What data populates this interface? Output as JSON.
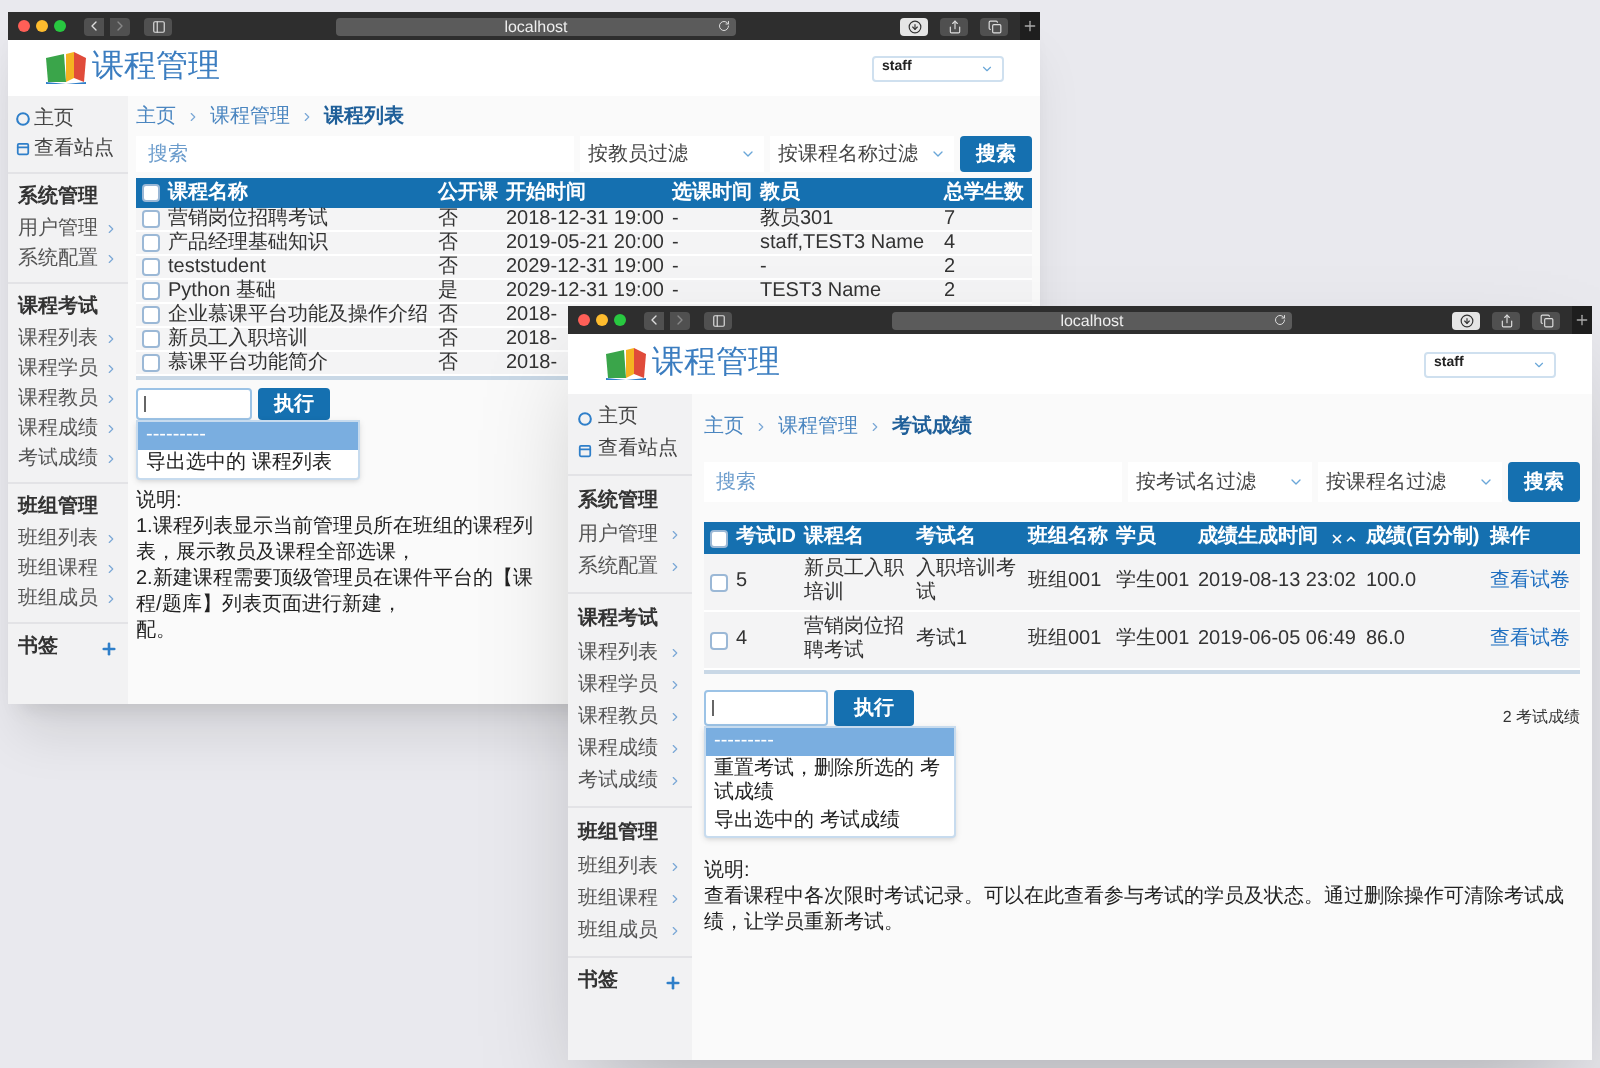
{
  "windows": [
    {
      "address": "localhost",
      "logo": "课程管理",
      "user": "staff",
      "sidebar": {
        "top": [
          {
            "kind": "home",
            "label": "主页"
          },
          {
            "kind": "site",
            "label": "查看站点"
          }
        ],
        "sections": [
          {
            "title": "系统管理",
            "items": [
              "用户管理",
              "系统配置"
            ]
          },
          {
            "title": "课程考试",
            "items": [
              "课程列表",
              "课程学员",
              "课程教员",
              "课程成绩",
              "考试成绩"
            ]
          },
          {
            "title": "班组管理",
            "items": [
              "班组列表",
              "班组课程",
              "班组成员"
            ]
          }
        ],
        "bookmarks": "书签"
      },
      "breadcrumb": [
        "主页",
        "课程管理",
        "课程列表"
      ],
      "search": {
        "placeholder": "搜索",
        "filters": [
          "按教员过滤",
          "按课程名称过滤"
        ],
        "button": "搜索"
      },
      "table": {
        "select_all": {
          "checked": false
        },
        "columns": [
          {
            "label": "课程名称",
            "kind": "text",
            "sorted": false
          },
          {
            "label": "公开课",
            "kind": "text",
            "sorted": false
          },
          {
            "label": "开始时间",
            "kind": "text",
            "sorted": false
          },
          {
            "label": "选课时间",
            "kind": "text",
            "sorted": false
          },
          {
            "label": "教员",
            "kind": "text",
            "sorted": false
          },
          {
            "label": "总学生数",
            "kind": "text",
            "sorted": false
          }
        ],
        "rows": [
          {
            "checked": false,
            "cells": [
              "营销岗位招聘考试",
              "否",
              "2018-12-31 19:00",
              "-",
              "教员301",
              "7"
            ]
          },
          {
            "checked": false,
            "cells": [
              "产品经理基础知识",
              "否",
              "2019-05-21 20:00",
              "-",
              "staff,TEST3 Name",
              "4"
            ]
          },
          {
            "checked": false,
            "cells": [
              "teststudent",
              "否",
              "2029-12-31 19:00",
              "-",
              "-",
              "2"
            ]
          },
          {
            "checked": false,
            "cells": [
              "Python 基础",
              "是",
              "2029-12-31 19:00",
              "-",
              "TEST3 Name",
              "2"
            ]
          },
          {
            "checked": false,
            "cells": [
              "企业慕课平台功能及操作介绍",
              "否",
              "2018-"
            ]
          },
          {
            "checked": false,
            "cells": [
              "新员工入职培训",
              "否",
              "2018-"
            ]
          },
          {
            "checked": false,
            "cells": [
              "慕课平台功能简介",
              "否",
              "2018-"
            ]
          }
        ]
      },
      "actions": {
        "options": [
          {
            "label": "---------",
            "selected": true
          },
          {
            "label": "导出选中的 课程列表",
            "selected": false
          }
        ],
        "button": "执行"
      },
      "notes": [
        "说明:",
        "1.课程列表显示当前管理员所在班组的课程列表，展示教员及课程全部选课，",
        "2.新建课程需要顶级管理员在课件平台的【课程/题库】列表页面进行新建，",
        "配。"
      ]
    },
    {
      "address": "localhost",
      "logo": "课程管理",
      "user": "staff",
      "sidebar": {
        "top": [
          {
            "kind": "home",
            "label": "主页"
          },
          {
            "kind": "site",
            "label": "查看站点"
          }
        ],
        "sections": [
          {
            "title": "系统管理",
            "items": [
              "用户管理",
              "系统配置"
            ]
          },
          {
            "title": "课程考试",
            "items": [
              "课程列表",
              "课程学员",
              "课程教员",
              "课程成绩",
              "考试成绩"
            ]
          },
          {
            "title": "班组管理",
            "items": [
              "班组列表",
              "班组课程",
              "班组成员"
            ]
          }
        ],
        "bookmarks": "书签"
      },
      "breadcrumb": [
        "主页",
        "课程管理",
        "考试成绩"
      ],
      "search": {
        "placeholder": "搜索",
        "filters": [
          "按考试名过滤",
          "按课程名过滤"
        ],
        "button": "搜索"
      },
      "table": {
        "select_all": {
          "checked": false
        },
        "columns": [
          {
            "label": "考试ID",
            "kind": "text",
            "sorted": false
          },
          {
            "label": "课程名",
            "kind": "text",
            "sorted": false
          },
          {
            "label": "考试名",
            "kind": "text",
            "sorted": false
          },
          {
            "label": "班组名称",
            "kind": "text",
            "sorted": false
          },
          {
            "label": "学员",
            "kind": "text",
            "sorted": false
          },
          {
            "label": "成绩生成时间",
            "kind": "text",
            "sorted": true
          },
          {
            "label": "成绩(百分制)",
            "kind": "text",
            "sorted": false
          },
          {
            "label": "操作",
            "kind": "link",
            "sorted": false
          }
        ],
        "rows": [
          {
            "checked": false,
            "cells": [
              "5",
              "新员工入职培训",
              "入职培训考试",
              "班组001",
              "学生001",
              "2019-08-13 23:02",
              "100.0",
              "查看试卷"
            ]
          },
          {
            "checked": false,
            "cells": [
              "4",
              "营销岗位招聘考试",
              "考试1",
              "班组001",
              "学生001",
              "2019-06-05 06:49",
              "86.0",
              "查看试卷"
            ]
          }
        ]
      },
      "actions": {
        "options": [
          {
            "label": "---------",
            "selected": true
          },
          {
            "label": "重置考试，删除所选的 考试成绩",
            "selected": false
          },
          {
            "label": "导出选中的 考试成绩",
            "selected": false
          }
        ],
        "button": "执行"
      },
      "count": "2 考试成绩",
      "notes": [
        "说明:",
        "查看课程中各次限时考试记录。可以在此查看参与考试的学员及状态。通过删除操作可清除考试成绩，让学员重新考试。"
      ]
    }
  ]
}
